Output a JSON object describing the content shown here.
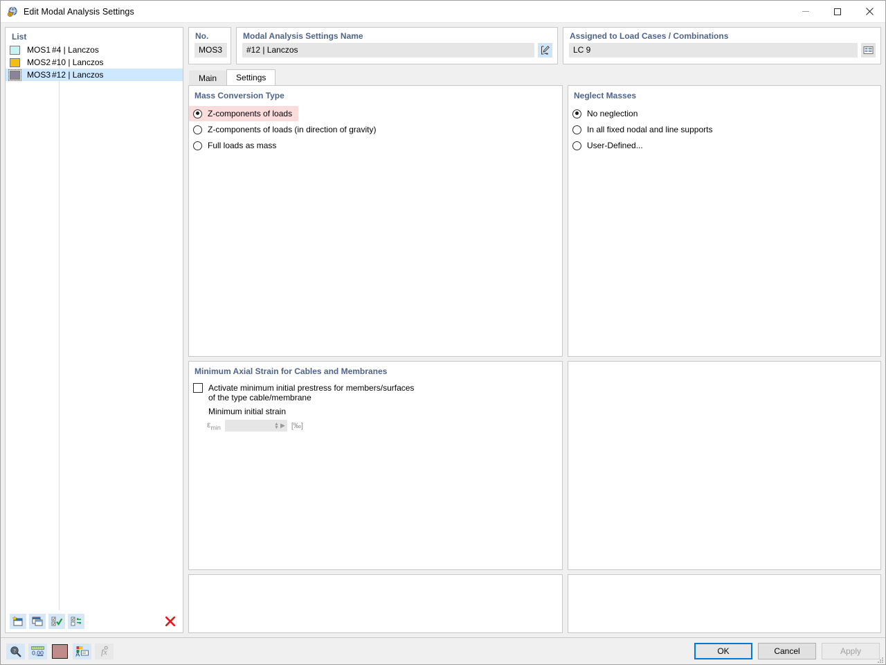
{
  "window": {
    "title": "Edit Modal Analysis Settings",
    "icon": "modal-analysis-icon",
    "minimize": "minimize-icon",
    "maximize": "maximize-icon",
    "close": "close-icon"
  },
  "list_panel": {
    "header": "List",
    "rows": [
      {
        "id": "MOS1",
        "description": "#4 | Lanczos",
        "color": "#c9f2f2",
        "selected": false
      },
      {
        "id": "MOS2",
        "description": "#10 | Lanczos",
        "color": "#f5bc12",
        "selected": false
      },
      {
        "id": "MOS3",
        "description": "#12 | Lanczos",
        "color": "#8b839b",
        "selected": true
      }
    ],
    "toolbar": [
      {
        "name": "new-item-button",
        "icon": "new-window-star-icon"
      },
      {
        "name": "duplicate-item-button",
        "icon": "copy-window-icon"
      },
      {
        "name": "select-all-button",
        "icon": "checklist-check-icon"
      },
      {
        "name": "invert-selection-button",
        "icon": "checklist-swap-icon"
      },
      {
        "name": "delete-item-button",
        "icon": "red-x-icon"
      }
    ]
  },
  "header": {
    "no_label": "No.",
    "no_value": "MOS3",
    "name_label": "Modal Analysis Settings Name",
    "name_value": "#12 | Lanczos",
    "name_edit_icon": "pencil-edit-icon",
    "assigned_label": "Assigned to Load Cases / Combinations",
    "assigned_value": "LC 9",
    "assigned_picker_icon": "table-list-icon"
  },
  "tabs": [
    {
      "label": "Main",
      "active": false
    },
    {
      "label": "Settings",
      "active": true
    }
  ],
  "mass_conversion": {
    "title": "Mass Conversion Type",
    "options": [
      {
        "label": "Z-components of loads",
        "selected": true,
        "highlighted": true
      },
      {
        "label": "Z-components of loads (in direction of gravity)",
        "selected": false,
        "highlighted": false
      },
      {
        "label": "Full loads as mass",
        "selected": false,
        "highlighted": false
      }
    ],
    "highlight_color": "#fadcdc"
  },
  "neglect_masses": {
    "title": "Neglect Masses",
    "options": [
      {
        "label": "No neglection",
        "selected": true
      },
      {
        "label": "In all fixed nodal and line supports",
        "selected": false
      },
      {
        "label": "User-Defined...",
        "selected": false
      }
    ]
  },
  "min_axial_strain": {
    "title": "Minimum Axial Strain for Cables and Membranes",
    "checkbox_label_line1": "Activate minimum initial prestress for members/surfaces",
    "checkbox_label_line2": "of the type cable/membrane",
    "checkbox_checked": false,
    "sub_label": "Minimum initial strain",
    "field_symbol": "ε",
    "field_subscript": "min",
    "field_value": "",
    "unit": "[‰]"
  },
  "footer": {
    "icons": [
      {
        "name": "search-magnifier-button",
        "icon": "magnifier-icon",
        "disabled": false
      },
      {
        "name": "numeric-format-button",
        "icon": "number-000-icon",
        "disabled": false
      },
      {
        "name": "color-swatch-button",
        "icon": "color-swatch-icon",
        "disabled": false,
        "color": "#bf8b8b"
      },
      {
        "name": "display-properties-button",
        "icon": "render-properties-icon",
        "disabled": false
      },
      {
        "name": "formula-button",
        "icon": "fx-formula-icon",
        "disabled": true
      }
    ],
    "ok_label": "OK",
    "cancel_label": "Cancel",
    "apply_label": "Apply",
    "apply_disabled": true,
    "focus_color": "#0078d7"
  }
}
